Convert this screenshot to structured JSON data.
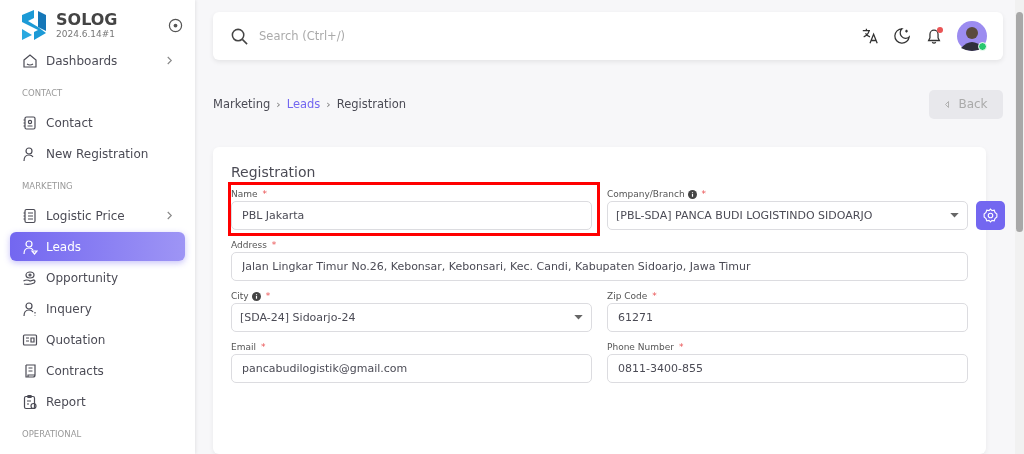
{
  "brand": {
    "name": "SOLOG",
    "version": "2024.6.14#1"
  },
  "sidebar": {
    "items": [
      {
        "kind": "item",
        "label": "Dashboards",
        "expandable": true,
        "selected": false
      },
      {
        "kind": "section",
        "label": "CONTACT"
      },
      {
        "kind": "item",
        "label": "Contact",
        "expandable": false,
        "selected": false
      },
      {
        "kind": "item",
        "label": "New Registration",
        "expandable": false,
        "selected": false
      },
      {
        "kind": "section",
        "label": "MARKETING"
      },
      {
        "kind": "item",
        "label": "Logistic Price",
        "expandable": true,
        "selected": false
      },
      {
        "kind": "item",
        "label": "Leads",
        "expandable": false,
        "selected": true
      },
      {
        "kind": "item",
        "label": "Opportunity",
        "expandable": false,
        "selected": false
      },
      {
        "kind": "item",
        "label": "Inquery",
        "expandable": false,
        "selected": false
      },
      {
        "kind": "item",
        "label": "Quotation",
        "expandable": false,
        "selected": false
      },
      {
        "kind": "item",
        "label": "Contracts",
        "expandable": false,
        "selected": false
      },
      {
        "kind": "item",
        "label": "Report",
        "expandable": false,
        "selected": false
      },
      {
        "kind": "section",
        "label": "OPERATIONAL"
      }
    ]
  },
  "topbar": {
    "search": {
      "placeholder": "Search (Ctrl+/)"
    },
    "notifications": true,
    "online": true
  },
  "breadcrumb": [
    {
      "label": "Marketing",
      "link": false
    },
    {
      "separator": "›",
      "label": "Leads",
      "link": true
    },
    {
      "separator": "›",
      "label": "Registration",
      "link": false
    }
  ],
  "back_button": {
    "label": "Back",
    "disabled": true
  },
  "form": {
    "title": "Registration",
    "rows": [
      [
        {
          "label": "Name",
          "required_mark": "*",
          "kind": "text",
          "value": "PBL Jakarta",
          "highlighted": true
        },
        {
          "label": "Company/Branch",
          "required_mark": "*",
          "kind": "select",
          "value": "[PBL-SDA] PANCA BUDI LOGISTINDO SIDOARJO",
          "info": true,
          "settings_button": true
        }
      ],
      [
        {
          "label": "Address",
          "required_mark": "*",
          "kind": "text",
          "value": "Jalan Lingkar Timur No.26, Kebonsar, Kebonsari, Kec. Candi, Kabupaten Sidoarjo, Jawa Timur"
        }
      ],
      [
        {
          "label": "City",
          "required_mark": "*",
          "kind": "select",
          "value": "[SDA-24] Sidoarjo-24",
          "info": true
        },
        {
          "label": "Zip Code",
          "required_mark": "*",
          "kind": "text",
          "value": "61271"
        }
      ],
      [
        {
          "label": "Email",
          "required_mark": "*",
          "kind": "text",
          "value": "pancabudilogistik@gmail.com"
        },
        {
          "label": "Phone Number",
          "required_mark": "*",
          "kind": "text",
          "value": "0811-3400-855"
        }
      ]
    ]
  }
}
